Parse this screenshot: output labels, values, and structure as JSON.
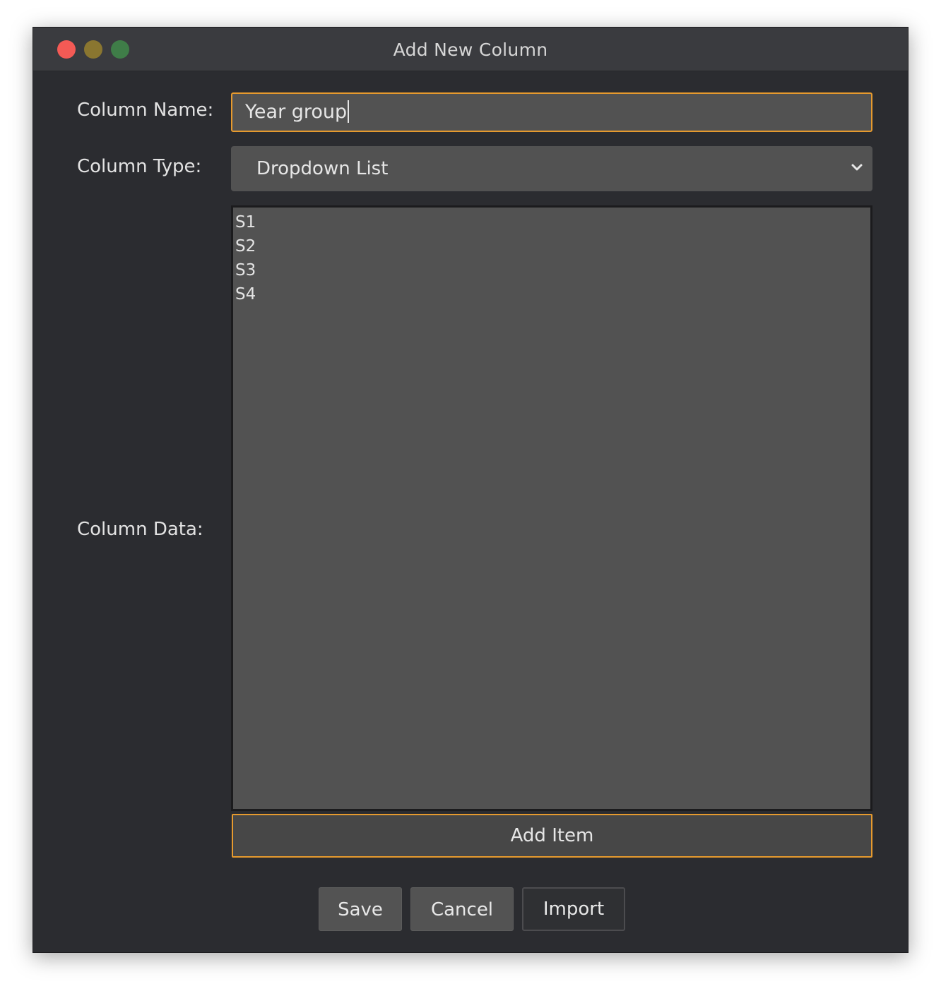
{
  "window": {
    "title": "Add New Column"
  },
  "form": {
    "column_name_label": "Column Name:",
    "column_name_value": "Year group",
    "column_type_label": "Column Type:",
    "column_type_value": "Dropdown List",
    "column_data_label": "Column Data:",
    "column_data_items": [
      "S1",
      "S2",
      "S3",
      "S4"
    ],
    "add_item_label": "Add Item"
  },
  "buttons": {
    "save": "Save",
    "cancel": "Cancel",
    "import": "Import"
  },
  "colors": {
    "focus_accent": "#e69a2e",
    "close": "#f45a55",
    "minimize": "#8a7630",
    "maximize": "#3f7d48"
  }
}
